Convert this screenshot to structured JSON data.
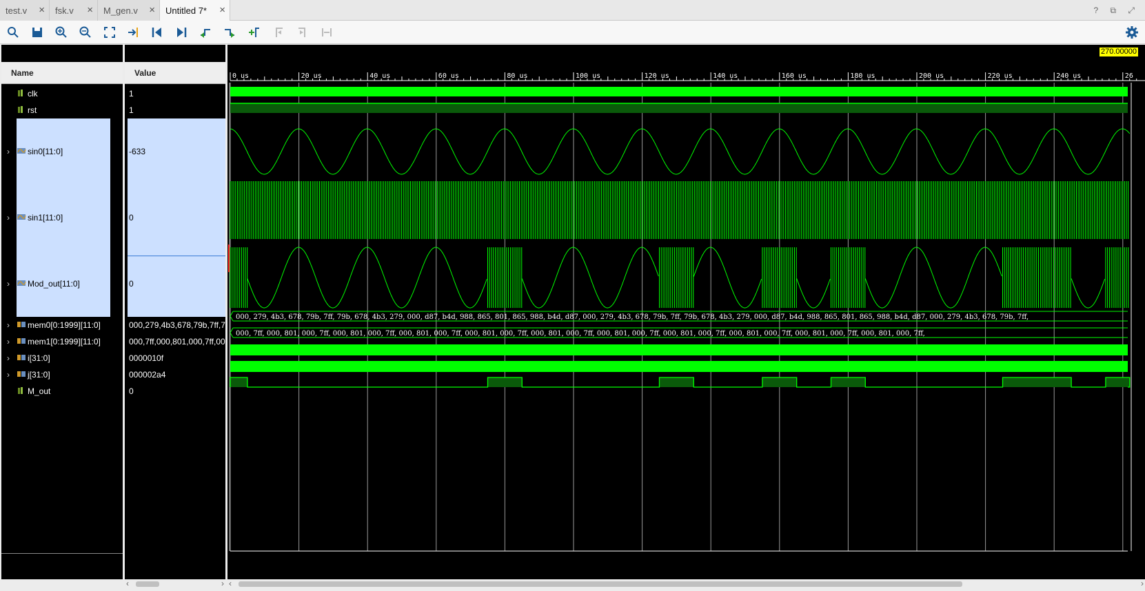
{
  "tabs": [
    {
      "label": "test.v",
      "active": false
    },
    {
      "label": "fsk.v",
      "active": false
    },
    {
      "label": "M_gen.v",
      "active": false
    },
    {
      "label": "Untitled 7*",
      "active": true
    }
  ],
  "window_controls": "? ⧉ ⤢",
  "columns": {
    "name": "Name",
    "value": "Value"
  },
  "signals": [
    {
      "name": "clk",
      "value": "1",
      "icon": "logic-icon",
      "expandable": false
    },
    {
      "name": "rst",
      "value": "1",
      "icon": "logic-icon",
      "expandable": false
    },
    {
      "name": "sin0[11:0]",
      "value": "-633",
      "icon": "analog-bus-icon",
      "expandable": true
    },
    {
      "name": "sin1[11:0]",
      "value": "0",
      "icon": "analog-bus-icon",
      "expandable": true
    },
    {
      "name": "Mod_out[11:0]",
      "value": "0",
      "icon": "analog-bus-icon",
      "expandable": true
    },
    {
      "name": "mem0[0:1999][11:0]",
      "value": "000,279,4b3,678,79b,7ff,7",
      "icon": "array-icon",
      "expandable": true
    },
    {
      "name": "mem1[0:1999][11:0]",
      "value": "000,7ff,000,801,000,7ff,00",
      "icon": "array-icon",
      "expandable": true
    },
    {
      "name": "i[31:0]",
      "value": "0000010f",
      "icon": "bus-icon",
      "expandable": true
    },
    {
      "name": "j[31:0]",
      "value": "000002a4",
      "icon": "bus-icon",
      "expandable": true
    },
    {
      "name": "M_out",
      "value": "0",
      "icon": "logic-icon",
      "expandable": false
    }
  ],
  "cursor_time": "270.00000",
  "time_ticks": [
    "0 us",
    "20 us",
    "40 us",
    "60 us",
    "80 us",
    "100 us",
    "120 us",
    "140 us",
    "160 us",
    "180 us",
    "200 us",
    "220 us",
    "240 us",
    "26"
  ],
  "mem0_text": "000, 279, 4b3, 678, 79b, 7ff, 79b, 678, 4b3, 279, 000, d87, b4d, 988, 865, 801, 865, 988, b4d, d87, 000, 279, 4b3, 678, 79b, 7ff, 79b, 678, 4b3, 279, 000, d87, b4d, 988, 865, 801, 865, 988, b4d, d87, 000, 279, 4b3, 678, 79b, 7ff,",
  "mem1_text": "000, 7ff, 000, 801, 000, 7ff, 000, 801, 000, 7ff, 000, 801, 000, 7ff, 000, 801, 000, 7ff, 000, 801, 000, 7ff, 000, 801, 000, 7ff, 000, 801, 000, 7ff, 000, 801, 000, 7ff, 000, 801, 000, 7ff, 000, 801, 000, 7ff,",
  "m_out_high_intervals_us": [
    [
      0,
      5
    ],
    [
      75,
      85
    ],
    [
      125,
      135
    ],
    [
      155,
      165
    ],
    [
      175,
      185
    ],
    [
      225,
      245
    ],
    [
      255,
      262
    ]
  ],
  "colors": {
    "wave": "#00ff00",
    "wave_dark": "#0a5a0a",
    "selection": "#cce0ff",
    "background": "#000000",
    "cursor_label": "#ffff00"
  }
}
